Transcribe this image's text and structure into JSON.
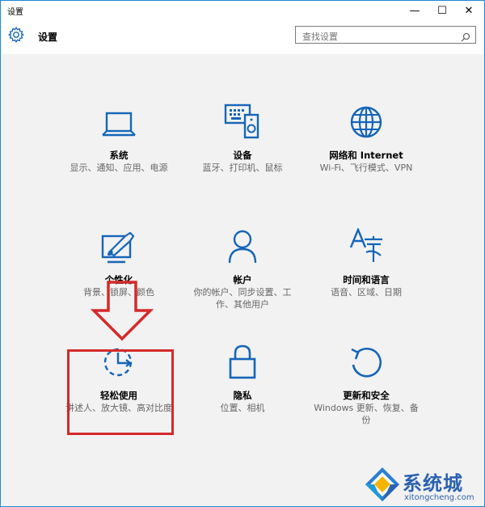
{
  "window": {
    "title": "设置",
    "controls": {
      "minimize": "—",
      "maximize": "☐",
      "close": "✕"
    }
  },
  "header": {
    "title": "设置"
  },
  "search": {
    "placeholder": "查找设置"
  },
  "tiles": [
    {
      "name": "系统",
      "desc": "显示、通知、应用、电源",
      "icon": "laptop-icon"
    },
    {
      "name": "设备",
      "desc": "蓝牙、打印机、鼠标",
      "icon": "devices-icon"
    },
    {
      "name": "网络和 Internet",
      "desc": "Wi-Fi、飞行模式、VPN",
      "icon": "globe-icon"
    },
    {
      "name": "个性化",
      "desc": "背景、锁屏、颜色",
      "icon": "personalization-icon"
    },
    {
      "name": "帐户",
      "desc": "你的帐户、同步设置、工作、其他用户",
      "icon": "person-icon"
    },
    {
      "name": "时间和语言",
      "desc": "语音、区域、日期",
      "icon": "time-language-icon"
    },
    {
      "name": "轻松使用",
      "desc": "讲述人、放大镜、高对比度",
      "icon": "ease-of-access-icon"
    },
    {
      "name": "隐私",
      "desc": "位置、相机",
      "icon": "lock-icon"
    },
    {
      "name": "更新和安全",
      "desc": "Windows 更新、恢复、备份",
      "icon": "update-icon"
    }
  ],
  "watermark": {
    "brand": "系统城",
    "url": "xitongcheng.com"
  },
  "colors": {
    "accent": "#1565b8",
    "highlight": "#d42a2a",
    "border": "#1e88d3"
  }
}
